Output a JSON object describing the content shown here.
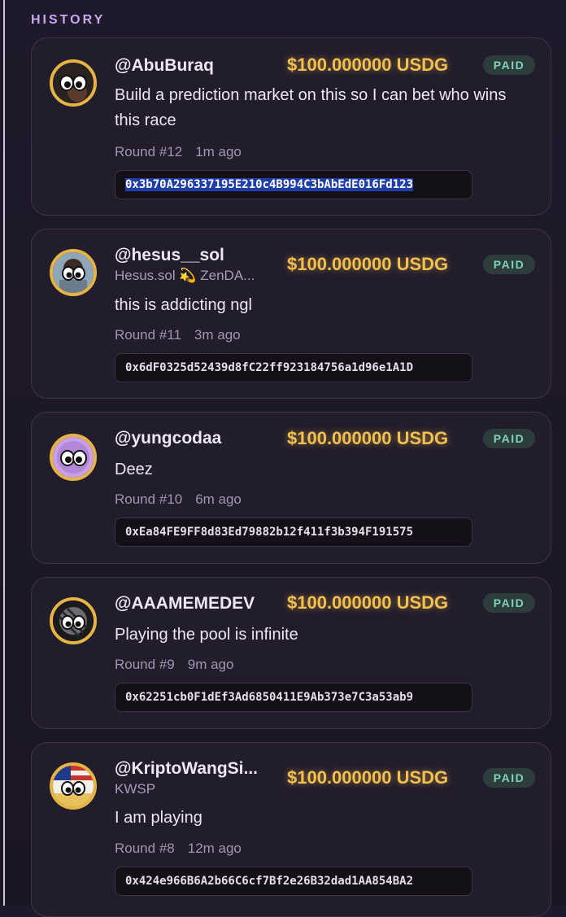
{
  "section_title": "HISTORY",
  "colors": {
    "amount": "#f3bf4e",
    "paid_badge": "#7fd4b7",
    "accent": "#c8a6f2"
  },
  "entries": [
    {
      "handle": "@AbuBuraq",
      "subname": "",
      "amount": "$100.000000 USDG",
      "status": "PAID",
      "message": "Build a prediction market on this so I can bet who wins this race",
      "round": "Round #12",
      "time_ago": "1m ago",
      "tx_hash": "0x3b70A296337195E210c4B994C3bAbEdE016Fd123",
      "tx_selected": true,
      "avatar_icon": "dark-avatar-icon"
    },
    {
      "handle": "@hesus__sol",
      "subname": "Hesus.sol 💫 ZenDA...",
      "amount": "$100.000000 USDG",
      "status": "PAID",
      "message": "this is addicting ngl",
      "round": "Round #11",
      "time_ago": "3m ago",
      "tx_hash": "0x6dF0325d52439d8fC22ff923184756a1d96e1A1D",
      "tx_selected": false,
      "avatar_icon": "photo-avatar-icon"
    },
    {
      "handle": "@yungcodaa",
      "subname": "",
      "amount": "$100.000000 USDG",
      "status": "PAID",
      "message": "Deez",
      "round": "Round #10",
      "time_ago": "6m ago",
      "tx_hash": "0xEa84FE9FF8d83Ed79882b12f411f3b394F191575",
      "tx_selected": false,
      "avatar_icon": "purple-avatar-icon"
    },
    {
      "handle": "@AAAMEMEDEV",
      "subname": "",
      "amount": "$100.000000 USDG",
      "status": "PAID",
      "message": "Playing the pool is infinite",
      "round": "Round #9",
      "time_ago": "9m ago",
      "tx_hash": "0x62251cb0F1dEf3Ad6850411E9Ab373e7C3a53ab9",
      "tx_selected": false,
      "avatar_icon": "striped-avatar-icon"
    },
    {
      "handle": "@KriptoWangSi...",
      "subname": "KWSP",
      "amount": "$100.000000 USDG",
      "status": "PAID",
      "message": "I am playing",
      "round": "Round #8",
      "time_ago": "12m ago",
      "tx_hash": "0x424e966B6A2b66C6cf7Bf2e26B32dad1AA854BA2",
      "tx_selected": false,
      "avatar_icon": "flag-avatar-icon"
    }
  ]
}
